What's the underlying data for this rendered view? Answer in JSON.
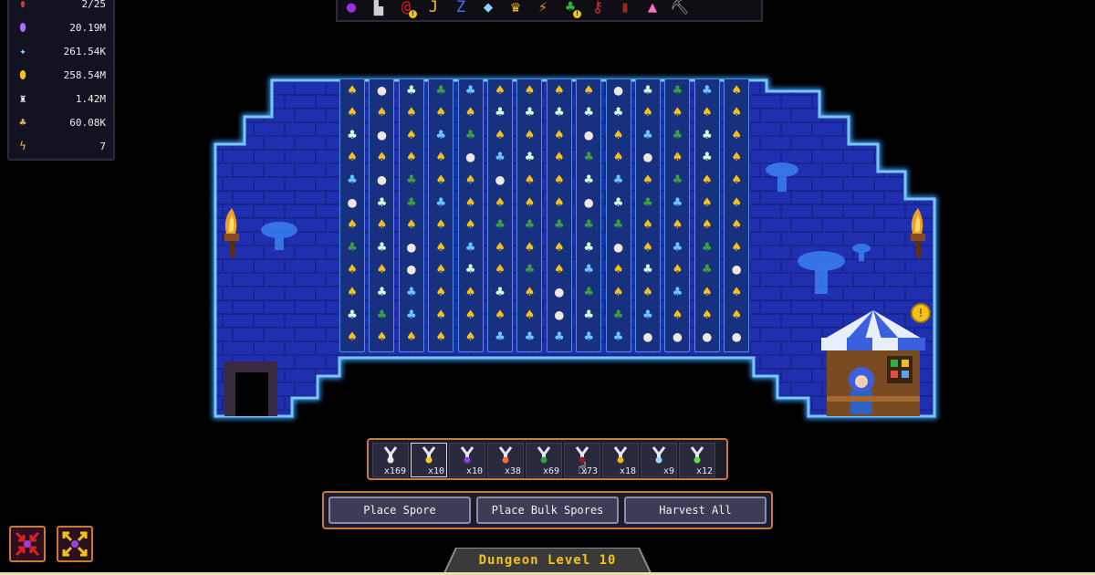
{
  "resources": [
    {
      "icon": "potion-icon",
      "color": "#d04030",
      "value": "2/25"
    },
    {
      "icon": "purple-gem-icon",
      "color": "#b070ff",
      "value": "20.19M"
    },
    {
      "icon": "crystal-icon",
      "color": "#6ae8ff",
      "value": "261.54K"
    },
    {
      "icon": "gold-coin-icon",
      "color": "#f2c21b",
      "value": "258.54M"
    },
    {
      "icon": "candle-icon",
      "color": "#f0f0f0",
      "value": "1.42M"
    },
    {
      "icon": "mushroom-pile-icon",
      "color": "#e0b060",
      "value": "60.08K"
    },
    {
      "icon": "lightning-icon",
      "color": "#f2c21b",
      "value": "7"
    }
  ],
  "toolbar": [
    {
      "icon": "purple-orb-icon",
      "glyph": "●",
      "color": "#9a30e0",
      "badge": false
    },
    {
      "icon": "stool-icon",
      "glyph": "▙",
      "color": "#d0d0d0",
      "badge": false
    },
    {
      "icon": "red-spiral-icon",
      "glyph": "@",
      "color": "#e02020",
      "badge": true
    },
    {
      "icon": "yellow-hook-icon",
      "glyph": "J",
      "color": "#f2c21b",
      "badge": false
    },
    {
      "icon": "sleep-z-icon",
      "glyph": "Z",
      "color": "#4a70ff",
      "badge": false
    },
    {
      "icon": "diamond-icon",
      "glyph": "◆",
      "color": "#8ad8ff",
      "badge": false
    },
    {
      "icon": "trophy-icon",
      "glyph": "♛",
      "color": "#f2c21b",
      "badge": false
    },
    {
      "icon": "bolt-icon",
      "glyph": "⚡",
      "color": "#f08a20",
      "badge": false
    },
    {
      "icon": "green-mushroom-icon",
      "glyph": "♣",
      "color": "#30b040",
      "badge": true
    },
    {
      "icon": "key-icon",
      "glyph": "⚷",
      "color": "#d03030",
      "badge": false
    },
    {
      "icon": "red-book-icon",
      "glyph": "▮",
      "color": "#a02818",
      "badge": false
    },
    {
      "icon": "pink-flask-icon",
      "glyph": "▲",
      "color": "#ff70d0",
      "badge": false
    },
    {
      "icon": "pickaxe-icon",
      "glyph": "⛏",
      "color": "#b0b0b8",
      "badge": false
    }
  ],
  "spores": [
    {
      "color": "#e8e8f0",
      "count": "x169"
    },
    {
      "color": "#f2d020",
      "count": "x10"
    },
    {
      "color": "#8a40e0",
      "count": "x10"
    },
    {
      "color": "#f07040",
      "count": "x38"
    },
    {
      "color": "#30a040",
      "count": "x69"
    },
    {
      "color": "#802030",
      "count": "x73"
    },
    {
      "color": "#f2b020",
      "count": "x18"
    },
    {
      "color": "#a0d8ff",
      "count": "x9"
    },
    {
      "color": "#60e040",
      "count": "x12"
    }
  ],
  "actions": {
    "place_spore": "Place Spore",
    "place_bulk": "Place Bulk Spores",
    "harvest_all": "Harvest All"
  },
  "dungeon_level": "Dungeon Level 10"
}
